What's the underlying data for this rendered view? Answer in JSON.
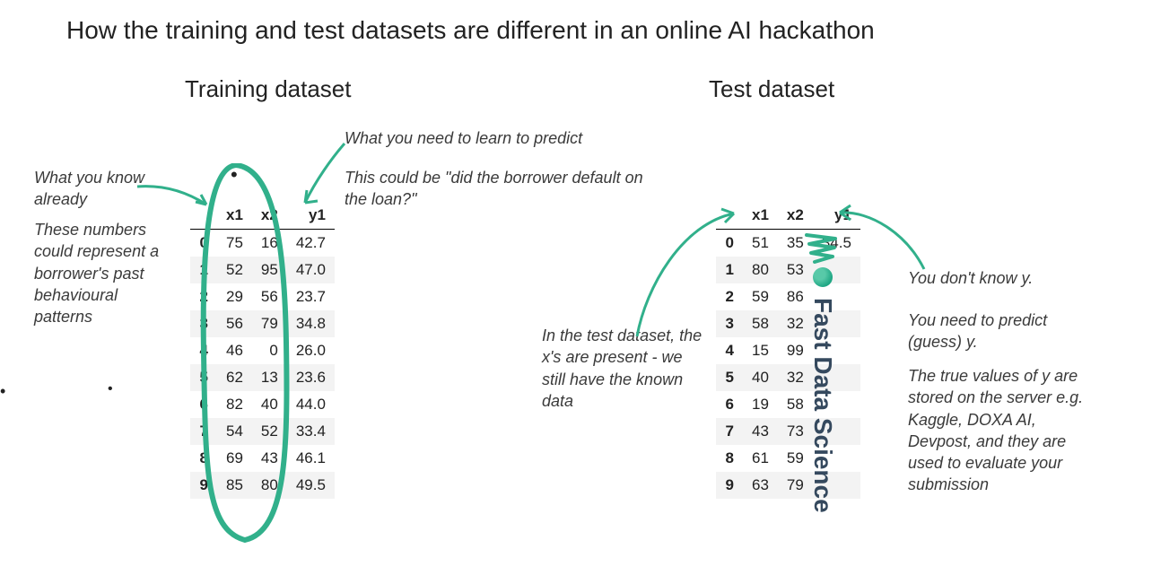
{
  "title": "How the training and test datasets are different in an online AI hackathon",
  "sections": {
    "training": "Training dataset",
    "test": "Test dataset"
  },
  "notes": {
    "known": "What you know already",
    "patterns": "These numbers could represent a borrower's past behavioural patterns",
    "learn": "What you need to learn to predict",
    "could_be": "This could be \"did the borrower default on the loan?\"",
    "test_x": "In the test dataset, the x's are present - we still have the known data",
    "unknown_y": "You don't know y.",
    "predict_y": "You need to predict (guess) y.",
    "true_y": "The true values of y are stored on the server e.g. Kaggle, DOXA AI, Devpost, and they are used to evaluate your submission"
  },
  "chart_data": {
    "type": "table",
    "training": {
      "columns": [
        "",
        "x1",
        "x2",
        "y1"
      ],
      "rows": [
        [
          "0",
          "75",
          "16",
          "42.7"
        ],
        [
          "1",
          "52",
          "95",
          "47.0"
        ],
        [
          "2",
          "29",
          "56",
          "23.7"
        ],
        [
          "3",
          "56",
          "79",
          "34.8"
        ],
        [
          "4",
          "46",
          "0",
          "26.0"
        ],
        [
          "5",
          "62",
          "13",
          "23.6"
        ],
        [
          "6",
          "82",
          "40",
          "44.0"
        ],
        [
          "7",
          "54",
          "52",
          "33.4"
        ],
        [
          "8",
          "69",
          "43",
          "46.1"
        ],
        [
          "9",
          "85",
          "80",
          "49.5"
        ]
      ]
    },
    "test": {
      "columns": [
        "",
        "x1",
        "x2",
        "y1"
      ],
      "rows": [
        [
          "0",
          "51",
          "35",
          "34.5"
        ],
        [
          "1",
          "80",
          "53",
          ""
        ],
        [
          "2",
          "59",
          "86",
          ""
        ],
        [
          "3",
          "58",
          "32",
          ""
        ],
        [
          "4",
          "15",
          "99",
          ""
        ],
        [
          "5",
          "40",
          "32",
          ""
        ],
        [
          "6",
          "19",
          "58",
          ""
        ],
        [
          "7",
          "43",
          "73",
          ""
        ],
        [
          "8",
          "61",
          "59",
          ""
        ],
        [
          "9",
          "63",
          "79",
          ""
        ]
      ]
    }
  },
  "watermark": "Fast Data Science"
}
